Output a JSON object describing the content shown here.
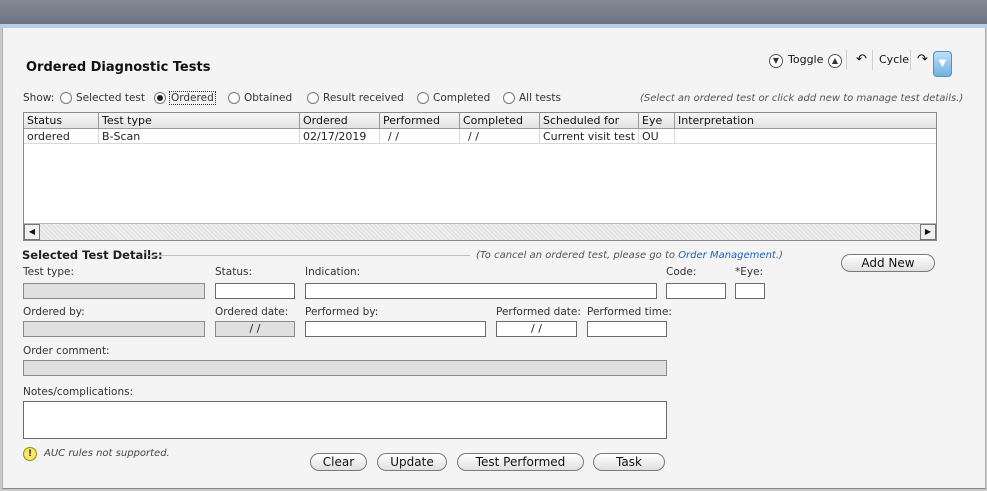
{
  "header": {
    "title": "Ordered Diagnostic Tests",
    "toggle_label": "Toggle",
    "cycle_label": "Cycle"
  },
  "show": {
    "label": "Show:",
    "options": [
      {
        "label": "Selected test",
        "selected": false
      },
      {
        "label": "Ordered",
        "selected": true
      },
      {
        "label": "Obtained",
        "selected": false
      },
      {
        "label": "Result received",
        "selected": false
      },
      {
        "label": "Completed",
        "selected": false
      },
      {
        "label": "All tests",
        "selected": false
      }
    ],
    "hint": "(Select an ordered test or click add new to manage test details.)"
  },
  "grid": {
    "columns": [
      "Status",
      "Test type",
      "Ordered",
      "Performed",
      "Completed",
      "Scheduled for",
      "Eye",
      "Interpretation"
    ],
    "rows": [
      [
        "ordered",
        "B-Scan",
        "02/17/2019",
        "/ /",
        "/ /",
        "Current visit test",
        "OU",
        ""
      ]
    ]
  },
  "details": {
    "title": "Selected Test Details:",
    "cancel_note": "(To cancel an ordered test, please go to ",
    "cancel_link": "Order Management",
    "cancel_note_end": ".)",
    "add_new": "Add New",
    "labels": {
      "test_type": "Test type:",
      "status": "Status:",
      "indication": "Indication:",
      "code": "Code:",
      "eye": "*Eye:",
      "ordered_by": "Ordered by:",
      "ordered_date": "Ordered date:",
      "performed_by": "Performed by:",
      "performed_date": "Performed date:",
      "performed_time": "Performed time:",
      "order_comment": "Order comment:",
      "notes": "Notes/complications:"
    },
    "values": {
      "ordered_date": "/ /",
      "performed_date": "/ /"
    },
    "auc_note": "AUC rules not supported."
  },
  "footer": {
    "clear": "Clear",
    "update": "Update",
    "test_performed": "Test Performed",
    "task": "Task"
  }
}
